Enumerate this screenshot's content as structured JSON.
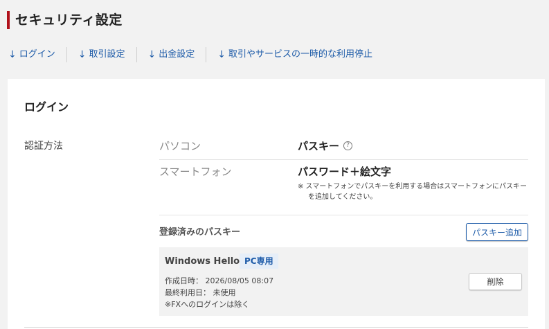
{
  "page": {
    "title": "セキュリティ設定"
  },
  "anchor_nav": [
    {
      "arrow": "↓",
      "label": "ログイン"
    },
    {
      "arrow": "↓",
      "label": "取引設定"
    },
    {
      "arrow": "↓",
      "label": "出金設定"
    },
    {
      "arrow": "↓",
      "label": "取引やサービスの一時的な利用停止"
    }
  ],
  "login": {
    "section_title": "ログイン",
    "auth_label": "認証方法",
    "methods": [
      {
        "device": "パソコン",
        "method": "パスキー",
        "help_icon": "?"
      },
      {
        "device": "スマートフォン",
        "method": "パスワード＋絵文字",
        "note": "※ スマートフォンでパスキーを利用する場合はスマートフォンにパスキーを追加してください。"
      }
    ],
    "passkeys": {
      "header": "登録済みのパスキー",
      "add_label": "パスキー追加",
      "items": [
        {
          "name": "Windows Hello",
          "badge": "PC専用",
          "created": "作成日時： 2026/08/05 08:07",
          "last_used": "最終利用日： 未使用",
          "note": "※FXへのログインは除く",
          "delete_label": "削除"
        }
      ]
    }
  },
  "colors": {
    "accent_red": "#b0111b",
    "link_blue": "#1d5ba8",
    "page_bg": "#f2f2f2"
  }
}
